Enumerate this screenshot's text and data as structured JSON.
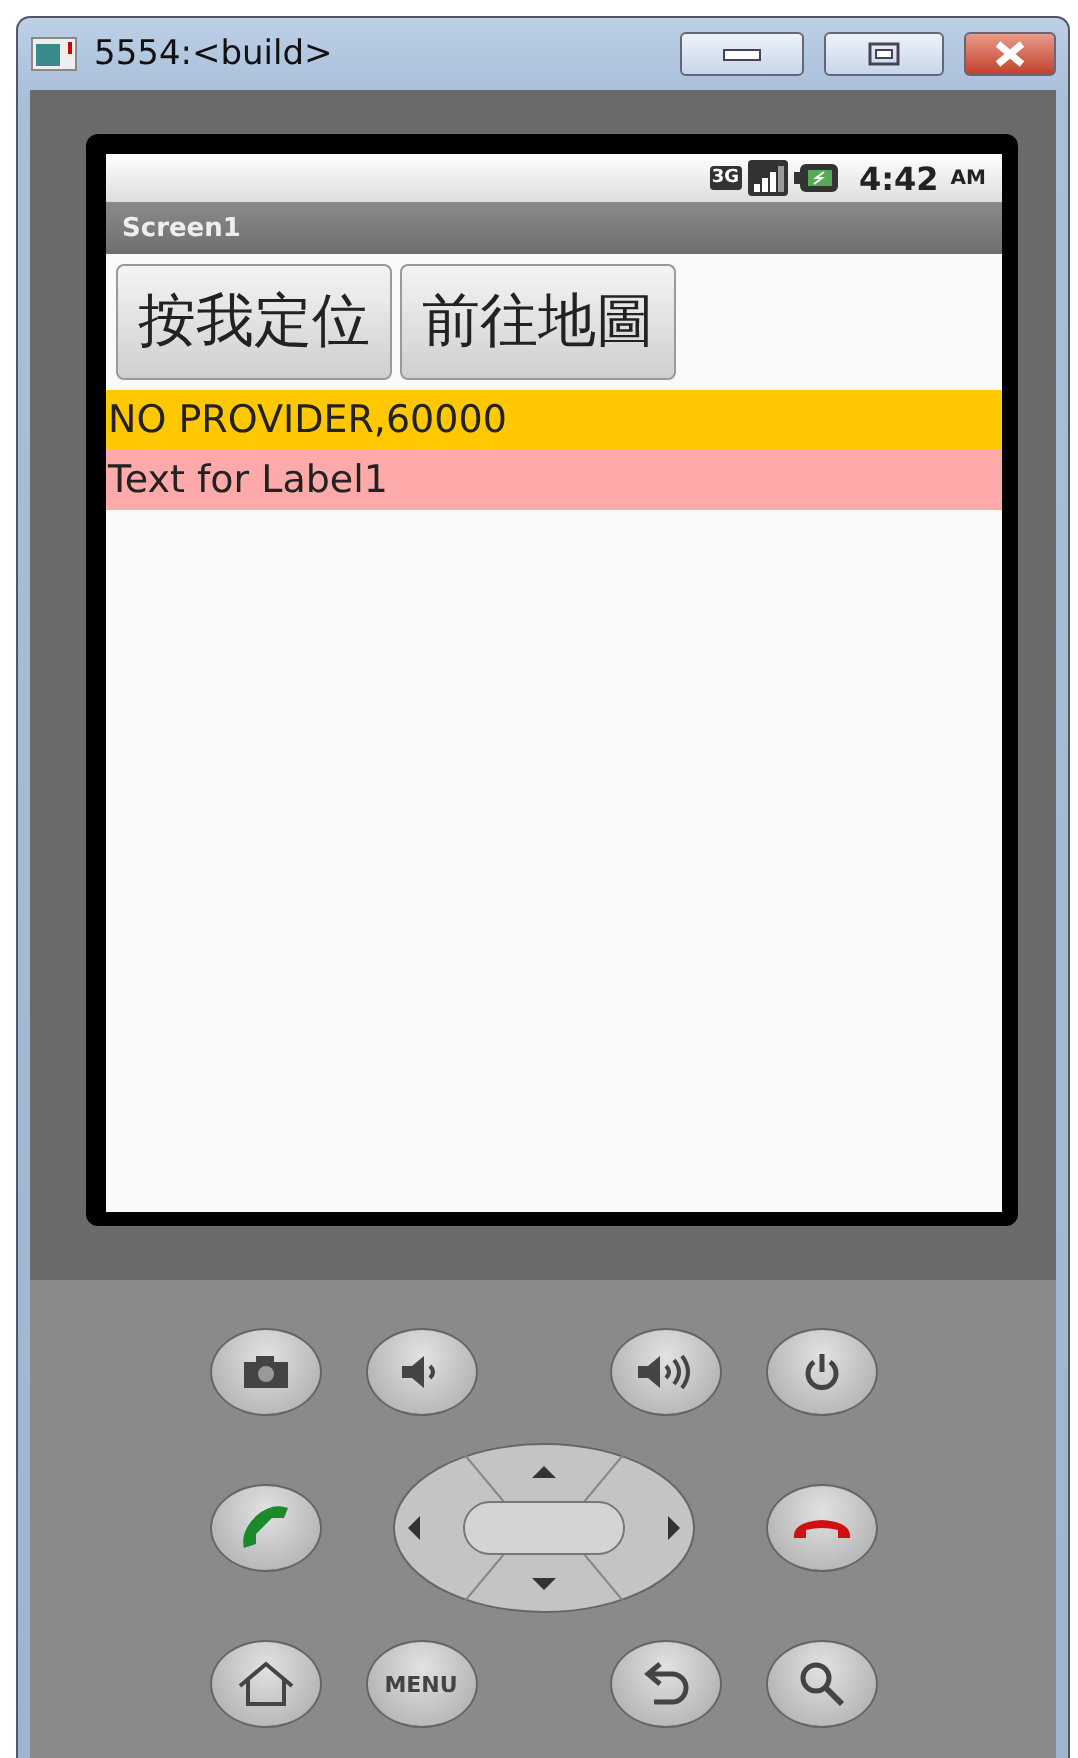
{
  "window": {
    "title": "5554:<build>"
  },
  "status_bar": {
    "network": "3G",
    "time": "4:42",
    "period": "AM"
  },
  "screen": {
    "title": "Screen1"
  },
  "buttons": [
    "按我定位",
    "前往地圖"
  ],
  "labels": [
    {
      "text": "NO PROVIDER,60000",
      "color": "#ffc800"
    },
    {
      "text": "Text for Label1",
      "color": "#ffaaaa"
    }
  ],
  "keys": [
    {
      "kind": "camera"
    },
    {
      "kind": "volume-down"
    },
    {
      "kind": "volume-up"
    },
    {
      "kind": "power"
    },
    {
      "kind": "call"
    },
    {
      "kind": "dpad"
    },
    {
      "kind": "end-call"
    },
    {
      "kind": "home"
    },
    {
      "kind": "menu",
      "label": "MENU"
    },
    {
      "kind": "back"
    },
    {
      "kind": "search"
    }
  ]
}
